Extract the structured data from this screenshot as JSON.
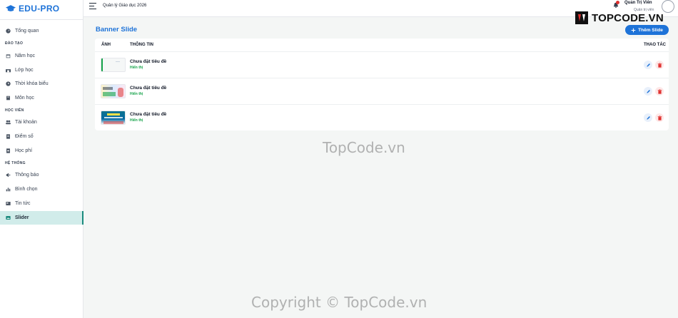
{
  "brand": {
    "name": "EDU-PRO",
    "accent": "#1e73d8"
  },
  "header": {
    "title": "Quản lý Giáo dục 2026",
    "user_name": "Quản Trị Viên",
    "user_role": "Quản trị viên"
  },
  "sidebar": {
    "overview": {
      "label": "Tổng quan",
      "icon": "dashboard-icon"
    },
    "sections": [
      {
        "title": "ĐÀO TẠO"
      },
      {
        "title": "HỌC VIÊN"
      },
      {
        "title": "HỆ THỐNG"
      }
    ],
    "items": [
      {
        "label": "Năm học",
        "icon": "calendar-icon"
      },
      {
        "label": "Lớp học",
        "icon": "school-icon"
      },
      {
        "label": "Thời khóa biểu",
        "icon": "clock-icon"
      },
      {
        "label": "Môn học",
        "icon": "book-icon"
      },
      {
        "label": "Tài khoản",
        "icon": "users-icon"
      },
      {
        "label": "Điểm số",
        "icon": "document-icon"
      },
      {
        "label": "Học phí",
        "icon": "receipt-icon"
      },
      {
        "label": "Thông báo",
        "icon": "megaphone-icon"
      },
      {
        "label": "Bình chọn",
        "icon": "chart-icon"
      },
      {
        "label": "Tin tức",
        "icon": "news-icon"
      },
      {
        "label": "Slider",
        "icon": "image-icon",
        "active": true
      }
    ]
  },
  "main": {
    "title": "Banner Slide",
    "add_button": "Thêm Slide",
    "columns": {
      "image": "ẢNH",
      "info": "THÔNG TIN",
      "actions": "THAO TÁC"
    },
    "rows": [
      {
        "title": "Chưa đặt tiêu đề",
        "status": "Hiển thị"
      },
      {
        "title": "Chưa đặt tiêu đề",
        "status": "Hiển thị"
      },
      {
        "title": "Chưa đặt tiêu đề",
        "status": "Hiển thị"
      }
    ]
  },
  "watermarks": {
    "logo": "TOPCODE.VN",
    "center": "TopCode.vn",
    "bottom": "Copyright © TopCode.vn"
  },
  "colors": {
    "active_bg": "#d1ecea",
    "active_bar": "#1a8a7d",
    "status_green": "#16a34a",
    "delete_red": "#e0312f"
  }
}
